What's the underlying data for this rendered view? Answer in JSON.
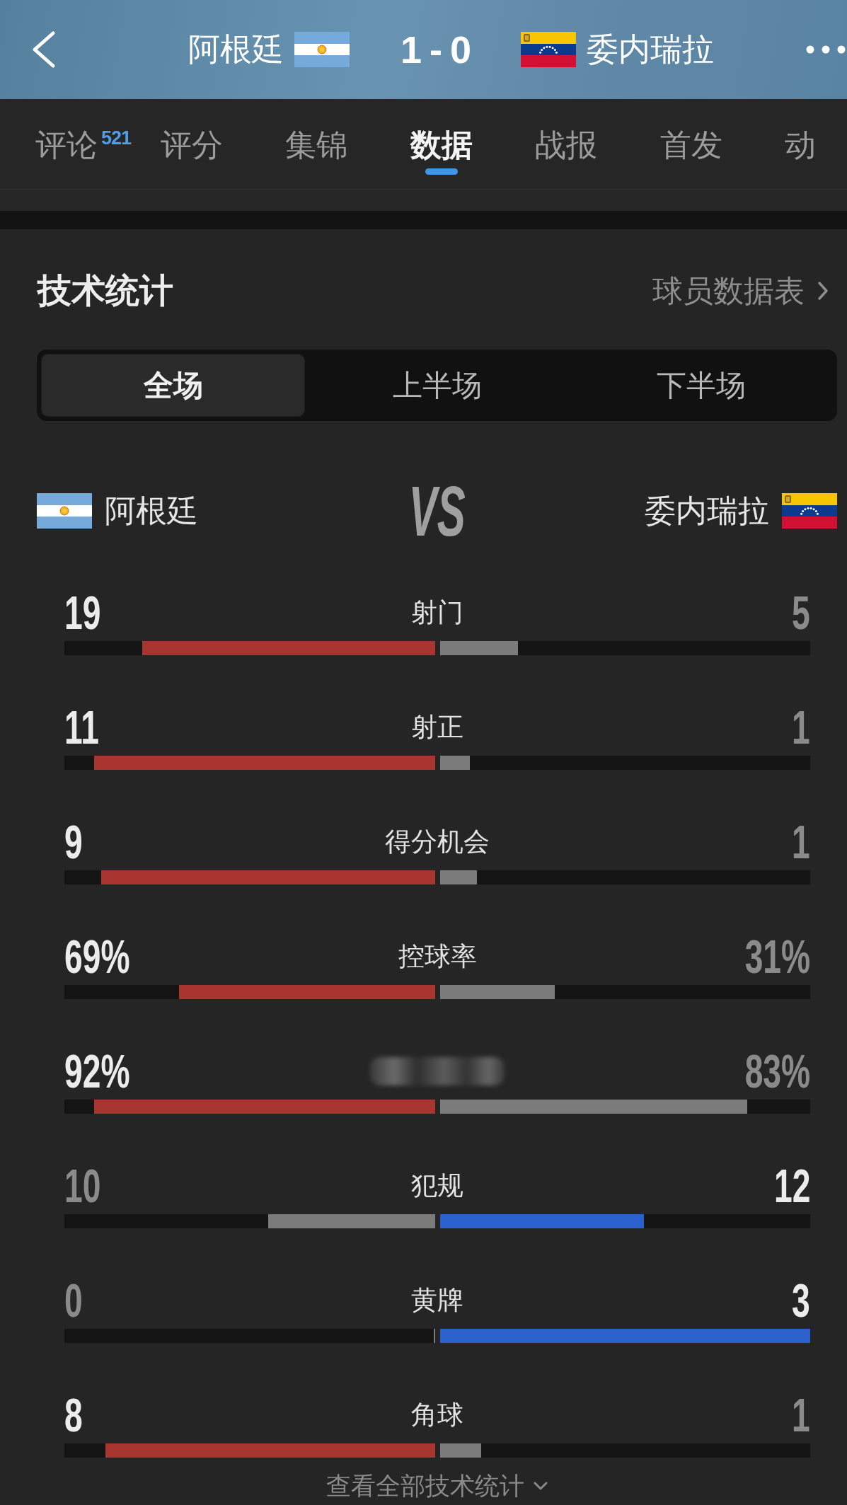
{
  "header": {
    "home": "阿根廷",
    "score": "1 - 0",
    "away": "委内瑞拉"
  },
  "tabs": [
    {
      "label": "评论",
      "badge": "521",
      "selected": false
    },
    {
      "label": "评分",
      "selected": false
    },
    {
      "label": "集锦",
      "selected": false
    },
    {
      "label": "数据",
      "selected": true
    },
    {
      "label": "战报",
      "selected": false
    },
    {
      "label": "首发",
      "selected": false
    },
    {
      "label": "动",
      "selected": false
    }
  ],
  "section": {
    "title": "技术统计",
    "link": "球员数据表"
  },
  "periods": [
    {
      "label": "全场",
      "selected": true
    },
    {
      "label": "上半场",
      "selected": false
    },
    {
      "label": "下半场",
      "selected": false
    }
  ],
  "teams": {
    "home": "阿根廷",
    "vs": "VS",
    "away": "委内瑞拉"
  },
  "stats": [
    {
      "label": "射门",
      "blurred": false,
      "home": {
        "value": "19",
        "level": 0.79,
        "leading": true
      },
      "away": {
        "value": "5",
        "level": 0.21,
        "leading": false
      }
    },
    {
      "label": "射正",
      "blurred": false,
      "home": {
        "value": "11",
        "level": 0.92,
        "leading": true
      },
      "away": {
        "value": "1",
        "level": 0.08,
        "leading": false
      }
    },
    {
      "label": "得分机会",
      "blurred": false,
      "home": {
        "value": "9",
        "level": 0.9,
        "leading": true
      },
      "away": {
        "value": "1",
        "level": 0.1,
        "leading": false
      }
    },
    {
      "label": "控球率",
      "blurred": false,
      "home": {
        "value": "69%",
        "level": 0.69,
        "leading": true
      },
      "away": {
        "value": "31%",
        "level": 0.31,
        "leading": false
      }
    },
    {
      "blurred": true,
      "home": {
        "value": "92%",
        "level": 0.92,
        "leading": true
      },
      "away": {
        "value": "83%",
        "level": 0.83,
        "leading": false
      }
    },
    {
      "label": "犯规",
      "blurred": false,
      "home": {
        "value": "10",
        "level": 0.45,
        "leading": false
      },
      "away": {
        "value": "12",
        "level": 0.55,
        "leading": true
      }
    },
    {
      "label": "黄牌",
      "blurred": false,
      "home": {
        "value": "0",
        "level": 0,
        "leading": false
      },
      "away": {
        "value": "3",
        "level": 1,
        "leading": true
      }
    },
    {
      "label": "角球",
      "blurred": false,
      "home": {
        "value": "8",
        "level": 0.89,
        "leading": true
      },
      "away": {
        "value": "1",
        "level": 0.11,
        "leading": false
      }
    }
  ],
  "more_link": "查看全部技术统计"
}
